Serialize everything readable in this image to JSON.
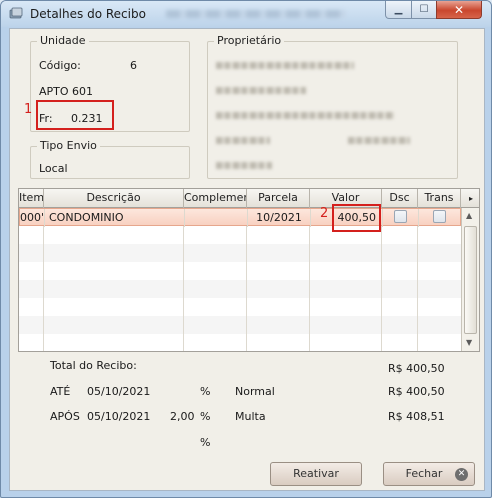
{
  "window": {
    "title": "Detalhes do Recibo"
  },
  "unidade": {
    "legend": "Unidade",
    "codigo_label": "Código:",
    "codigo_value": "6",
    "apto": "APTO 601",
    "fr_label": "Fr:",
    "fr_value": "0.231",
    "marker": "1"
  },
  "tipo_envio": {
    "legend": "Tipo Envio",
    "value": "Local"
  },
  "proprietario": {
    "legend": "Proprietário"
  },
  "grid": {
    "columns": [
      "Item",
      "Descrição",
      "Complemento",
      "Parcela",
      "Valor",
      "Dsc",
      "Trans"
    ],
    "rows": [
      {
        "item": "000'",
        "descricao": "CONDOMINIO",
        "complemento": "",
        "parcela": "10/2021",
        "valor": "400,50",
        "dsc": false,
        "trans": false
      }
    ],
    "marker": "2"
  },
  "totals": {
    "total_label": "Total do Recibo:",
    "total_value": "R$ 400,50",
    "ate_label": "ATÉ",
    "ate_date": "05/10/2021",
    "ate_pct": "%",
    "ate_type": "Normal",
    "ate_value": "R$ 400,50",
    "apos_label": "APÓS",
    "apos_date": "05/10/2021",
    "apos_rate": "2,00",
    "apos_pct": "%",
    "apos_type": "Multa",
    "apos_value": "R$ 408,51",
    "extra_pct": "%"
  },
  "buttons": {
    "reativar": "Reativar",
    "fechar": "Fechar"
  },
  "colors": {
    "highlight": "#d4201d",
    "selected_row": "#fde7dd"
  }
}
